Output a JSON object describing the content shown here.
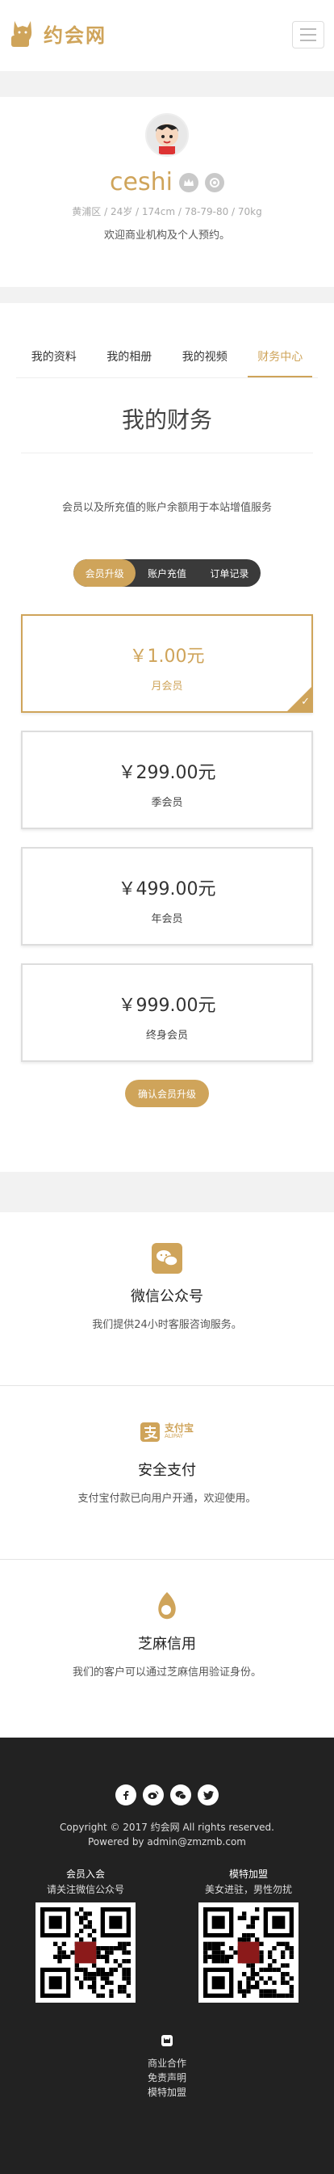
{
  "header": {
    "logo_text": "约会网",
    "logo_icon": "cat-logo-icon",
    "menu_icon": "hamburger-icon"
  },
  "profile": {
    "avatar_icon": "avatar-boy-icon",
    "name": "ceshi",
    "badges": [
      "crown-icon",
      "vip-icon"
    ],
    "meta": "黄浦区 / 24岁 / 174cm / 78-79-80 / 70kg",
    "intro": "欢迎商业机构及个人预约。"
  },
  "tabs": [
    {
      "label": "我的资料"
    },
    {
      "label": "我的相册"
    },
    {
      "label": "我的视频"
    },
    {
      "label": "财务中心",
      "active": true
    }
  ],
  "finance": {
    "title": "我的财务",
    "desc": "会员以及所充值的账户余额用于本站增值服务",
    "segments": [
      "会员升级",
      "账户充值",
      "订单记录"
    ],
    "active_segment": "会员升级",
    "plans": [
      {
        "price": "￥1.00元",
        "label": "月会员",
        "selected": true
      },
      {
        "price": "￥299.00元",
        "label": "季会员",
        "selected": false
      },
      {
        "price": "￥499.00元",
        "label": "年会员",
        "selected": false
      },
      {
        "price": "￥999.00元",
        "label": "终身会员",
        "selected": false
      }
    ],
    "confirm_label": "确认会员升级"
  },
  "features": [
    {
      "icon": "wechat-icon",
      "title": "微信公众号",
      "desc": "我们提供24小时客服咨询服务。"
    },
    {
      "icon": "alipay-icon",
      "title": "安全支付",
      "desc": "支付宝付款已向用户开通，欢迎使用。",
      "brand": "支付宝",
      "brand_sub": "ALIPAY"
    },
    {
      "icon": "sesame-icon",
      "title": "芝麻信用",
      "desc": "我们的客户可以通过芝麻信用验证身份。"
    }
  ],
  "footer": {
    "socials": [
      "facebook-icon",
      "weibo-icon",
      "wechat-icon",
      "twitter-icon"
    ],
    "copyright": "Copyright © 2017 约会网 All rights reserved.",
    "powered": "Powered by admin@zmzmb.com",
    "qrs": [
      {
        "title": "会员入会",
        "sub": "请关注微信公众号"
      },
      {
        "title": "模特加盟",
        "sub": "美女进驻，男性勿扰"
      }
    ],
    "links": [
      "商业合作",
      "免责声明",
      "模特加盟"
    ]
  },
  "colors": {
    "accent": "#cfa45a",
    "dark": "#222222"
  }
}
